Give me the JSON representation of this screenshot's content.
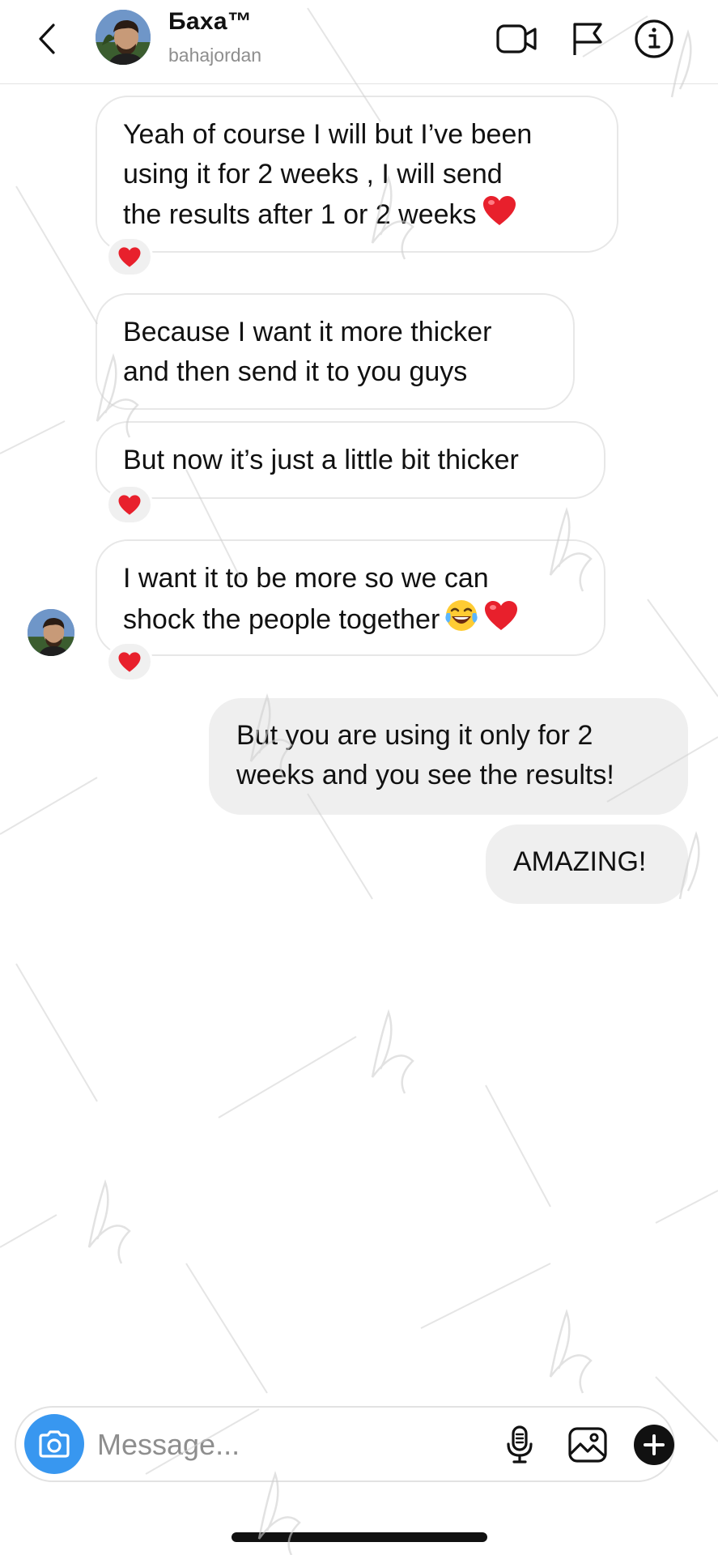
{
  "header": {
    "back_icon": "chevron-left-icon",
    "contact_name": "Баха™",
    "contact_username": "bahajordan",
    "icons": [
      "video-call-icon",
      "flag-icon",
      "info-icon"
    ]
  },
  "messages": [
    {
      "direction": "incoming",
      "lines": [
        "Yeah of course I will but I’ve been",
        "using it for 2 weeks , I will send",
        "the results after 1 or 2 weeks"
      ],
      "emoji": "red-heart",
      "reaction": "red-heart"
    },
    {
      "direction": "incoming",
      "lines": [
        "Because I want it more thicker",
        "and then send it to you guys"
      ]
    },
    {
      "direction": "incoming",
      "lines": [
        "But now it’s just a little bit thicker"
      ],
      "reaction": "red-heart"
    },
    {
      "direction": "incoming",
      "lines": [
        "I want it to be more so we can",
        "shock the people together"
      ],
      "emoji": "laughing-tears red-heart",
      "reaction": "red-heart",
      "avatar": true
    },
    {
      "direction": "outgoing",
      "lines": [
        "But you are using it only for 2",
        "weeks and you see the results!"
      ]
    },
    {
      "direction": "outgoing",
      "lines": [
        "AMAZING!"
      ]
    }
  ],
  "composer": {
    "placeholder": "Message...",
    "icons": [
      "camera-icon",
      "microphone-icon",
      "gallery-icon",
      "plus-icon"
    ]
  },
  "colors": {
    "accent": "#3897f0",
    "outgoing_bubble": "#efefef",
    "incoming_border": "#e7e7e7",
    "heart": "#e8202c"
  }
}
